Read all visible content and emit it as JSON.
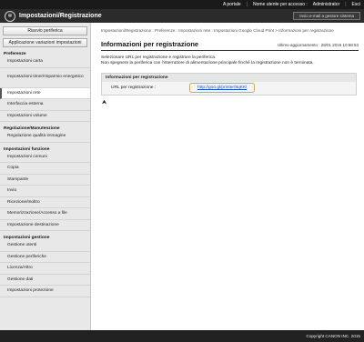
{
  "topbar": {
    "portal_link": "A portale",
    "user_label": "Nome utente per accesso :",
    "user_name": "Administrator",
    "logout": "Esci"
  },
  "header": {
    "title": "Impostazioni/Registrazione",
    "mail_button": "Invio e-mail a gestore sistema"
  },
  "sidebar": {
    "buttons": [
      "Riavvio periferica",
      "Applicazione variazioni impostazioni"
    ],
    "sections": [
      {
        "heading": "Preferenze",
        "items": [
          "Impostazioni carta",
          "Impostazioni timer/risparmio energetico",
          "Impostazioni rete",
          "Interfaccia esterna",
          "Impostazioni volume"
        ]
      },
      {
        "heading": "Regolazione/Manutenzione",
        "items": [
          "Regolazione qualità immagine"
        ]
      },
      {
        "heading": "Impostazioni funzione",
        "items": [
          "Impostazioni comuni",
          "Copia",
          "Stampante",
          "Invio",
          "Ricezione/Inoltro",
          "Memorizzazione/Accesso a file",
          "Impostazione destinazione"
        ]
      },
      {
        "heading": "Impostazioni gestione",
        "items": [
          "Gestione utenti",
          "Gestione periferiche",
          "Licenza/Altro",
          "Gestione dati",
          "Impostazioni protezione"
        ]
      }
    ]
  },
  "main": {
    "breadcrumb": "Impostazioni/Registrazione : Preferenze : Impostazioni rete : Impostazioni Google Cloud Print > Informazioni per registrazione",
    "title": "Informazioni per registrazione",
    "last_updated": "Ultimo aggiornamento : 28/01 2016 10:58:53",
    "description_line1": "Selezionare URL per registrazione e registrare la periferica.",
    "description_line2": "Non spegnere la periferica con l'interruttore di alimentazione principale finché la registrazione non è terminata.",
    "panel_title": "Informazioni per registrazione",
    "url_label": "URL per registrazione :",
    "url_value": "http://goo.gl/printer/8qKKl",
    "to_top_glyph": "⮝"
  },
  "footer": {
    "copyright": "Copyright CANON INC. 2015"
  },
  "icons": {
    "logo": "canon-remote-ui-logo-icon",
    "to_top": "arrow-up-to-top-icon"
  },
  "colors": {
    "header_bg": "#2b2b2b",
    "topbar_bg": "#1a1a1a",
    "link": "#1a4fbf",
    "highlight": "#f0a020"
  }
}
